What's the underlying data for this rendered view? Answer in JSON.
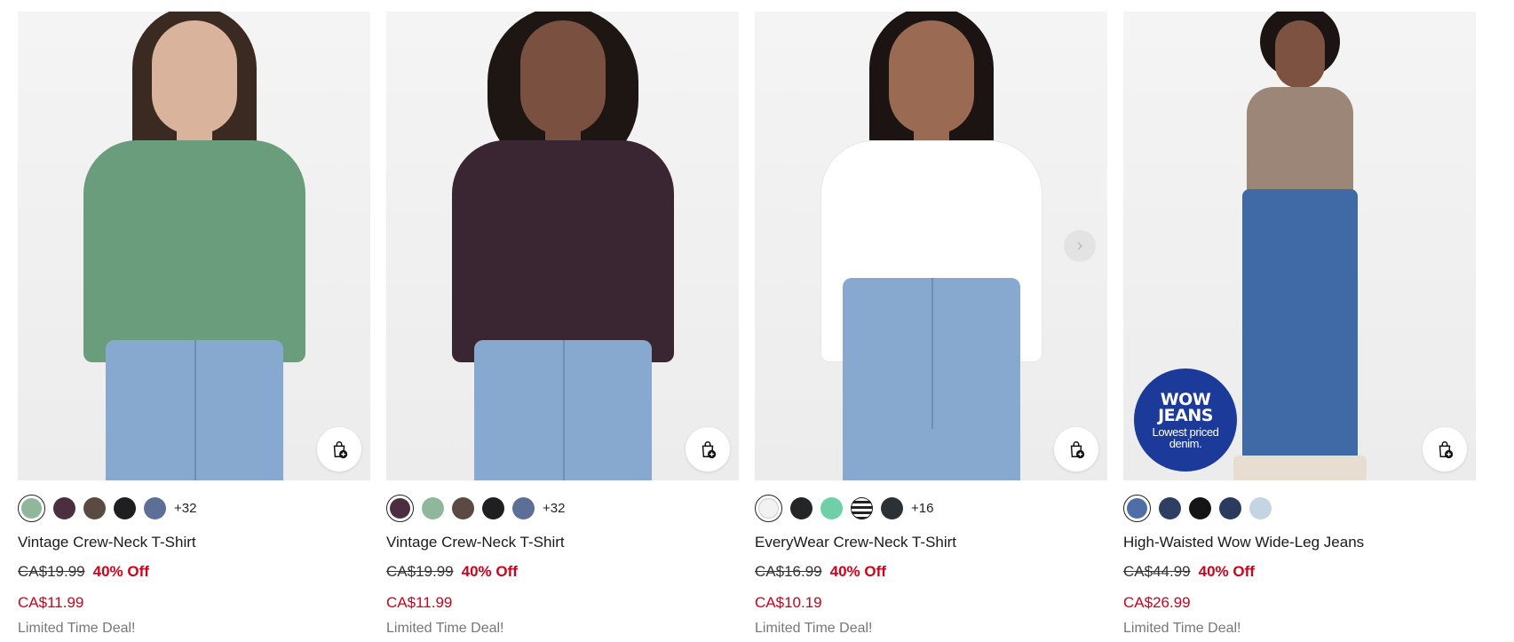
{
  "products": [
    {
      "name": "Vintage Crew-Neck T-Shirt",
      "original_price": "CA$19.99",
      "discount": "40% Off",
      "sale_price": "CA$11.99",
      "deal_text": "Limited Time Deal!",
      "shirt_color": "#6a9d7b",
      "swatches": [
        "#8fb79c",
        "#4b2f40",
        "#5b4a43",
        "#1f1f22",
        "#5c6f96"
      ],
      "more_colors": "+32"
    },
    {
      "name": "Vintage Crew-Neck T-Shirt",
      "original_price": "CA$19.99",
      "discount": "40% Off",
      "sale_price": "CA$11.99",
      "deal_text": "Limited Time Deal!",
      "shirt_color": "#3a2532",
      "swatches": [
        "#4b2f40",
        "#8fb79c",
        "#5b4a43",
        "#1f1f22",
        "#5c6f96"
      ],
      "more_colors": "+32"
    },
    {
      "name": "EveryWear Crew-Neck T-Shirt",
      "original_price": "CA$16.99",
      "discount": "40% Off",
      "sale_price": "CA$10.19",
      "deal_text": "Limited Time Deal!",
      "shirt_color": "#ffffff",
      "swatches": [
        "#f2f2f2",
        "#242527",
        "#6fd0a8",
        "stripe",
        "#2c3136"
      ],
      "more_colors": "+16"
    },
    {
      "name": "High-Waisted Wow Wide-Leg Jeans",
      "original_price": "CA$44.99",
      "discount": "40% Off",
      "sale_price": "CA$26.99",
      "deal_text": "Limited Time Deal!",
      "swatches": [
        "#4f6ea8",
        "#2d3f63",
        "#151518",
        "#2b3a5e",
        "#c4d4e4"
      ],
      "more_colors": "",
      "badge": {
        "line1": "WOW",
        "line2": "JEANS",
        "line3": "Lowest priced",
        "line4": "denim."
      }
    }
  ],
  "icons": {
    "add_to_bag": "shopping-bag-plus-icon",
    "next": "chevron-right-icon"
  },
  "colors": {
    "sale": "#d0021b",
    "badge": "#1b3a99"
  }
}
